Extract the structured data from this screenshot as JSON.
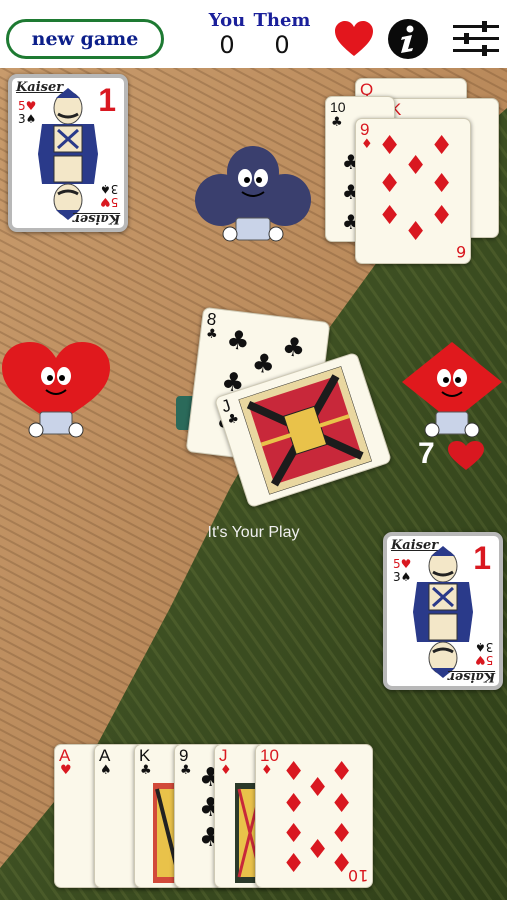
{
  "header": {
    "new_game_label": "new game",
    "you_label": "You",
    "them_label": "Them",
    "you_score": "0",
    "them_score": "0",
    "trump_suit_icon": "heart-icon",
    "info_icon": "info-icon",
    "settings_icon": "sliders-icon"
  },
  "players": {
    "north": {
      "character": "club",
      "color": "#3a3f6e"
    },
    "west": {
      "character": "heart",
      "color": "#e0191d"
    },
    "east": {
      "character": "diamond",
      "color": "#e0191d"
    }
  },
  "bid": {
    "value": "7",
    "suit_icon": "heart-icon"
  },
  "status_text": "It's Your Play",
  "score_cards": {
    "top_left": {
      "brand": "Kaiser",
      "number": "1",
      "small_ranks": "5♥ 3♠"
    },
    "bottom_right": {
      "brand": "Kaiser",
      "number": "1",
      "small_ranks": "5♥ 3♠"
    }
  },
  "tricks_pile": {
    "cards": [
      {
        "rank": "Q",
        "suit": "♥"
      },
      {
        "rank": "K",
        "suit": "♦"
      },
      {
        "rank": "10",
        "suit": "♣"
      },
      {
        "rank": "9",
        "suit": "♦"
      }
    ],
    "bottom_rank": "6"
  },
  "center_cards": [
    {
      "rank": "8",
      "suit": "♣"
    },
    {
      "rank": "J",
      "suit": "♣"
    }
  ],
  "hand": [
    {
      "rank": "A",
      "suit": "♥",
      "color": "red"
    },
    {
      "rank": "A",
      "suit": "♠",
      "color": "blk"
    },
    {
      "rank": "K",
      "suit": "♣",
      "color": "blk"
    },
    {
      "rank": "9",
      "suit": "♣",
      "color": "blk"
    },
    {
      "rank": "J",
      "suit": "♦",
      "color": "red"
    },
    {
      "rank": "10",
      "suit": "♦",
      "color": "red"
    }
  ]
}
